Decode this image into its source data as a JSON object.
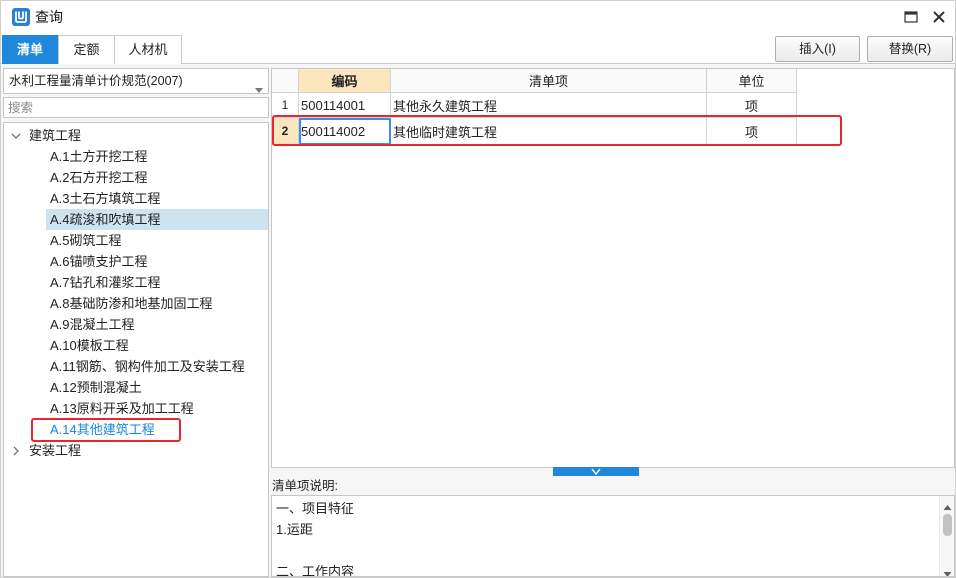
{
  "window": {
    "title": "查询"
  },
  "icons": {
    "app": "app-logo-icon",
    "maximize": "maximize-icon",
    "close": "close-icon",
    "spec_dropdown": "chevron-down-icon",
    "tree_expanded": "chevron-down-icon",
    "tree_collapsed": "chevron-right-icon",
    "splitter": "chevron-down-icon",
    "scroll_up": "scroll-up-icon",
    "scroll_down": "scroll-down-icon"
  },
  "tabs": [
    {
      "label": "清单",
      "active": true
    },
    {
      "label": "定额",
      "active": false
    },
    {
      "label": "人材机",
      "active": false
    }
  ],
  "toolbar": {
    "insert_label": "插入(I)",
    "replace_label": "替换(R)"
  },
  "sidebar": {
    "spec_select": {
      "value": "水利工程量清单计价规范(2007)"
    },
    "search": {
      "placeholder": "搜索"
    },
    "tree": [
      {
        "label": "建筑工程",
        "expanded": true,
        "children": [
          {
            "label": "A.1土方开挖工程"
          },
          {
            "label": "A.2石方开挖工程"
          },
          {
            "label": "A.3土石方填筑工程"
          },
          {
            "label": "A.4疏浚和吹填工程",
            "highlighted": true
          },
          {
            "label": "A.5砌筑工程"
          },
          {
            "label": "A.6锚喷支护工程"
          },
          {
            "label": "A.7钻孔和灌浆工程"
          },
          {
            "label": "A.8基础防渗和地基加固工程"
          },
          {
            "label": "A.9混凝土工程"
          },
          {
            "label": "A.10模板工程"
          },
          {
            "label": "A.11钢筋、钢构件加工及安装工程"
          },
          {
            "label": "A.12预制混凝土"
          },
          {
            "label": "A.13原料开采及加工工程"
          },
          {
            "label": "A.14其他建筑工程",
            "selected": true
          }
        ]
      },
      {
        "label": "安装工程",
        "expanded": false
      }
    ]
  },
  "table": {
    "headers": {
      "code": "编码",
      "name": "清单项",
      "unit": "单位"
    },
    "rows": [
      {
        "no": "1",
        "code": "500114001",
        "name": "其他永久建筑工程",
        "unit": "项",
        "selected": false
      },
      {
        "no": "2",
        "code": "500114002",
        "name": "其他临时建筑工程",
        "unit": "项",
        "selected": true
      }
    ]
  },
  "description": {
    "label": "清单项说明:",
    "lines": [
      "一、项目特征",
      "1.运距",
      "",
      "二、工作内容"
    ]
  },
  "colors": {
    "accent": "#1f87dc",
    "annotation_red": "#e8262b",
    "selected_text": "#1a87d9",
    "highlight_row": "#cde3ef",
    "current_cell": "#fbe6bf"
  }
}
